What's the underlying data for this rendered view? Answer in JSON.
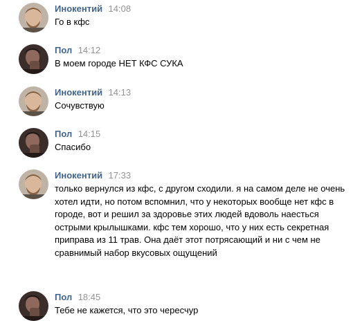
{
  "colors": {
    "author": "#42648b",
    "time": "#939393",
    "text": "#000000",
    "background": "#ffffff"
  },
  "messages": [
    {
      "author": "Инокентий",
      "time": "14:08",
      "avatar": "avatar-innokentiy",
      "text": "Го в кфс"
    },
    {
      "author": "Пол",
      "time": "14:12",
      "avatar": "avatar-pol",
      "text": "В моем городе НЕТ КФС СУКА"
    },
    {
      "author": "Инокентий",
      "time": "14:13",
      "avatar": "avatar-innokentiy",
      "text": "Сочувствую"
    },
    {
      "author": "Пол",
      "time": "14:15",
      "avatar": "avatar-pol",
      "text": "Спасибо"
    },
    {
      "author": "Инокентий",
      "time": "17:33",
      "avatar": "avatar-innokentiy",
      "text": "только вернулся из кфс, с другом сходили. я на самом деле не очень хотел идти, но потом вспомнил, что у некоторых вообще нет кфс в городе, вот и решил за здоровье этих людей вдоволь наесться острыми крылышками. кфс тем хорошо, что у них есть секретная приправа из 11 трав. Она даёт этот потрясающий и ни с чем не сравнимый набор вкусовых ощущений"
    },
    {
      "author": "Пол",
      "time": "18:45",
      "avatar": "avatar-pol",
      "text": "Тебе не кажется, что это чересчур"
    }
  ]
}
